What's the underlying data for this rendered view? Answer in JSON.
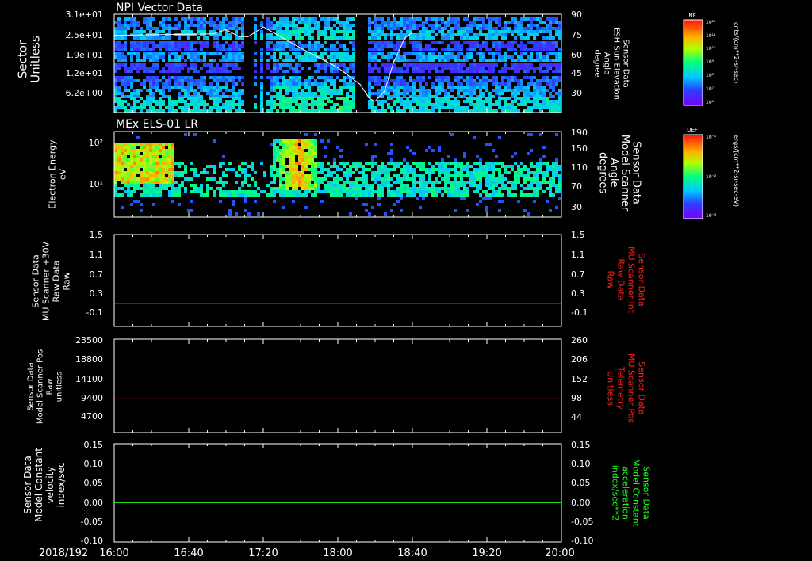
{
  "date_label": "2018/192",
  "time_ticks": [
    "16:00",
    "16:40",
    "17:20",
    "18:00",
    "18:40",
    "19:20",
    "20:00"
  ],
  "colors": {
    "red": "#ff2020",
    "green": "#20ff20",
    "white": "#ffffff"
  },
  "chart_data": [
    {
      "type": "heatmap",
      "title": "NPI Vector Data",
      "ylabel": "Sector\nUnitless",
      "yticks": [
        "3.1e+01",
        "2.5e+01",
        "1.9e+01",
        "1.2e+01",
        "6.2e+00"
      ],
      "ylabel_right": "Sensor Data\nESH Sun Elevation\nAngle\ndegree",
      "yticks_right": [
        "90",
        "75",
        "60",
        "45",
        "30"
      ],
      "overlay_line": {
        "name": "ESH Sun Elevation Angle",
        "x": [
          "16:00",
          "16:53",
          "17:00",
          "17:07",
          "17:12",
          "17:20",
          "17:40",
          "18:00",
          "18:12",
          "18:17",
          "18:20",
          "18:25",
          "18:30",
          "18:36",
          "18:40"
        ],
        "y": [
          75,
          76,
          79,
          74,
          74,
          81,
          66,
          52,
          40,
          30,
          28,
          35,
          56,
          73,
          77
        ]
      },
      "colorbar": {
        "label": "NF",
        "units": "cnts/(cm**2-sr-sec)",
        "ticks": [
          "10¹²",
          "10¹¹",
          "10¹⁰",
          "10⁹",
          "10⁸",
          "10⁷",
          "10⁶"
        ]
      }
    },
    {
      "type": "heatmap",
      "title": "MEx ELS-01 LR",
      "ylabel": "Electron Energy\neV",
      "yticks": [
        "10²",
        "10¹"
      ],
      "ylabel_right": "Sensor Data\nModel Scanner\nAngle\ndegrees",
      "yticks_right": [
        "190",
        "150",
        "110",
        "70",
        "30"
      ],
      "colorbar": {
        "label": "DEF",
        "units": "ergs/(cm**2-sr-sec-eV)",
        "ticks": [
          "10⁻¹",
          "10⁻²",
          "10⁻³"
        ]
      }
    },
    {
      "type": "line",
      "ylabel": "Sensor Data\nMU Scanner +30V\nRaw Data\nRaw",
      "yticks": [
        "1.5",
        "1.1",
        "0.7",
        "0.3",
        "-0.1"
      ],
      "ylim": [
        -0.5,
        1.5
      ],
      "ylabel_right": "Sensor Data\nMU Scanner Int\nRaw Data\nRaw",
      "yticks_right": [
        "1.5",
        "1.1",
        "0.7",
        "0.3",
        "-0.1"
      ],
      "series": [
        {
          "x": [
            "16:00",
            "20:00"
          ],
          "values": [
            0.0,
            0.0
          ]
        }
      ]
    },
    {
      "type": "line",
      "ylabel": "Sensor Data\nModel Scanner Pos\nRaw\nunitless",
      "yticks": [
        "23500",
        "18800",
        "14100",
        "9400",
        "4700"
      ],
      "ylim": [
        0,
        23500
      ],
      "ylabel_right": "Sensor Data\nMU Scanner Pos\nTelemetry\nUnitless",
      "yticks_right": [
        "260",
        "206",
        "152",
        "98",
        "44"
      ],
      "series": [
        {
          "x": [
            "16:00",
            "20:00"
          ],
          "values": [
            8500,
            8500
          ]
        }
      ]
    },
    {
      "type": "line",
      "ylabel": "Sensor Data\nModel Constant\nvelocity\nindex/sec",
      "yticks": [
        "0.15",
        "0.10",
        "0.05",
        "0.00",
        "-0.05",
        "-0.10"
      ],
      "ylim": [
        -0.1,
        0.15
      ],
      "ylabel_right": "Sensor Data\nModel Constant\nacceleration\nindex/sec**2",
      "yticks_right": [
        "0.15",
        "0.10",
        "0.05",
        "0.00",
        "-0.05",
        "-0.10"
      ],
      "series": [
        {
          "x": [
            "16:00",
            "20:00"
          ],
          "values": [
            0.0,
            0.0
          ]
        }
      ]
    }
  ]
}
